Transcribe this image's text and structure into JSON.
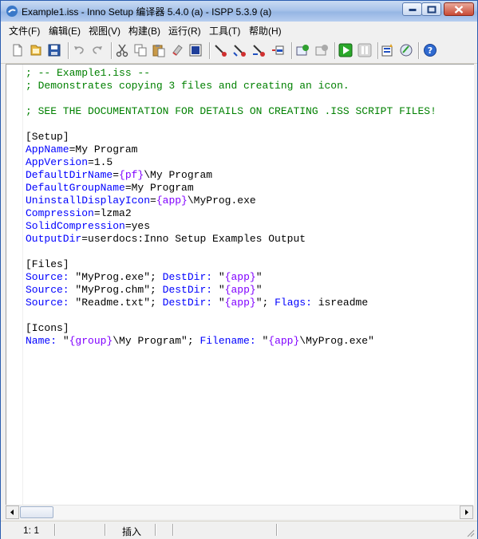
{
  "window": {
    "title": "Example1.iss - Inno Setup 编译器 5.4.0 (a) - ISPP 5.3.9 (a)"
  },
  "menu": [
    {
      "label": "文件(F)"
    },
    {
      "label": "编辑(E)"
    },
    {
      "label": "视图(V)"
    },
    {
      "label": "构建(B)"
    },
    {
      "label": "运行(R)"
    },
    {
      "label": "工具(T)"
    },
    {
      "label": "帮助(H)"
    }
  ],
  "toolbar_icons": [
    "new-file-icon",
    "open-file-icon",
    "save-icon",
    "undo-icon",
    "redo-icon",
    "cut-icon",
    "copy-icon",
    "paste-icon",
    "clear-icon",
    "select-all-icon",
    "compile-icon",
    "compile-stop-icon",
    "compile-next-icon",
    "step-into-icon",
    "step-over-icon",
    "run-icon",
    "pause-icon",
    "terminate-icon",
    "new-wizard-icon",
    "help-icon"
  ],
  "editor": {
    "lines": [
      [
        {
          "t": "; -- Example1.iss --",
          "c": "com"
        }
      ],
      [
        {
          "t": "; Demonstrates copying 3 files and creating an icon.",
          "c": "com"
        }
      ],
      [],
      [
        {
          "t": "; SEE THE DOCUMENTATION FOR DETAILS ON CREATING .ISS SCRIPT FILES!",
          "c": "com"
        }
      ],
      [],
      [
        {
          "t": "[Setup]",
          "c": "sec"
        }
      ],
      [
        {
          "t": "AppName",
          "c": "key"
        },
        {
          "t": "=My Program",
          "c": "txt"
        }
      ],
      [
        {
          "t": "AppVersion",
          "c": "key"
        },
        {
          "t": "=1.5",
          "c": "txt"
        }
      ],
      [
        {
          "t": "DefaultDirName",
          "c": "key"
        },
        {
          "t": "=",
          "c": "txt"
        },
        {
          "t": "{pf}",
          "c": "const"
        },
        {
          "t": "\\My Program",
          "c": "txt"
        }
      ],
      [
        {
          "t": "DefaultGroupName",
          "c": "key"
        },
        {
          "t": "=My Program",
          "c": "txt"
        }
      ],
      [
        {
          "t": "UninstallDisplayIcon",
          "c": "key"
        },
        {
          "t": "=",
          "c": "txt"
        },
        {
          "t": "{app}",
          "c": "const"
        },
        {
          "t": "\\MyProg.exe",
          "c": "txt"
        }
      ],
      [
        {
          "t": "Compression",
          "c": "key"
        },
        {
          "t": "=lzma2",
          "c": "txt"
        }
      ],
      [
        {
          "t": "SolidCompression",
          "c": "key"
        },
        {
          "t": "=yes",
          "c": "txt"
        }
      ],
      [
        {
          "t": "OutputDir",
          "c": "key"
        },
        {
          "t": "=userdocs:Inno Setup Examples Output",
          "c": "txt"
        }
      ],
      [],
      [
        {
          "t": "[Files]",
          "c": "sec"
        }
      ],
      [
        {
          "t": "Source:",
          "c": "key"
        },
        {
          "t": " \"MyProg.exe\"; ",
          "c": "txt"
        },
        {
          "t": "DestDir:",
          "c": "key"
        },
        {
          "t": " \"",
          "c": "txt"
        },
        {
          "t": "{app}",
          "c": "const"
        },
        {
          "t": "\"",
          "c": "txt"
        }
      ],
      [
        {
          "t": "Source:",
          "c": "key"
        },
        {
          "t": " \"MyProg.chm\"; ",
          "c": "txt"
        },
        {
          "t": "DestDir:",
          "c": "key"
        },
        {
          "t": " \"",
          "c": "txt"
        },
        {
          "t": "{app}",
          "c": "const"
        },
        {
          "t": "\"",
          "c": "txt"
        }
      ],
      [
        {
          "t": "Source:",
          "c": "key"
        },
        {
          "t": " \"Readme.txt\"; ",
          "c": "txt"
        },
        {
          "t": "DestDir:",
          "c": "key"
        },
        {
          "t": " \"",
          "c": "txt"
        },
        {
          "t": "{app}",
          "c": "const"
        },
        {
          "t": "\"; ",
          "c": "txt"
        },
        {
          "t": "Flags:",
          "c": "key"
        },
        {
          "t": " isreadme",
          "c": "txt"
        }
      ],
      [],
      [
        {
          "t": "[Icons]",
          "c": "sec"
        }
      ],
      [
        {
          "t": "Name:",
          "c": "key"
        },
        {
          "t": " \"",
          "c": "txt"
        },
        {
          "t": "{group}",
          "c": "const"
        },
        {
          "t": "\\My Program\"; ",
          "c": "txt"
        },
        {
          "t": "Filename:",
          "c": "key"
        },
        {
          "t": " \"",
          "c": "txt"
        },
        {
          "t": "{app}",
          "c": "const"
        },
        {
          "t": "\\MyProg.exe\"",
          "c": "txt"
        }
      ]
    ]
  },
  "status": {
    "position": "1:  1",
    "mode": "插入"
  },
  "colors": {
    "comment": "#008000",
    "keyword": "#0000ff",
    "constant": "#8000ff",
    "text": "#000000"
  }
}
